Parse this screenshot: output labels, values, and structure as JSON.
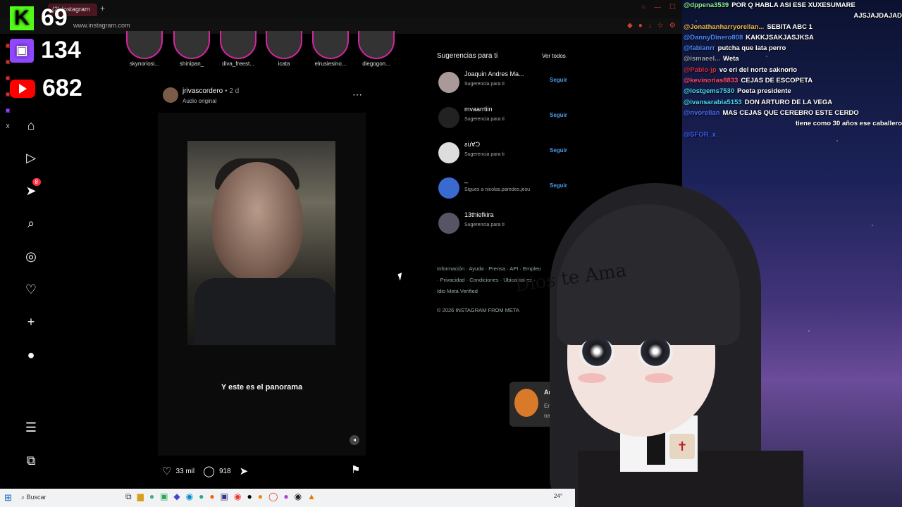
{
  "browser": {
    "tab_title": "(2) Instagram",
    "url": "www.instagram.com"
  },
  "counters": {
    "kick": "69",
    "twitch": "134",
    "youtube": "682"
  },
  "stories": [
    {
      "name": "skynoriosi..."
    },
    {
      "name": "shinipan_"
    },
    {
      "name": "diva_freest..."
    },
    {
      "name": "icata"
    },
    {
      "name": "elrusiesino..."
    },
    {
      "name": "diegogon..."
    }
  ],
  "nav": {
    "notifications_badge": "8"
  },
  "post": {
    "username": "jrivascordero",
    "time": "2 d",
    "audio": "Audio original",
    "subtitle": "Y este es el panorama",
    "likes": "33 mil",
    "comments": "918"
  },
  "suggestions": {
    "title": "Sugerencias para ti",
    "see_all": "Ver todos",
    "follow_label": "Seguir",
    "items": [
      {
        "name": "Joaquin Andres Ma...",
        "sub": "Sugerencia para ti"
      },
      {
        "name": "mvaarrtiin",
        "sub": "Sugerencia para ti"
      },
      {
        "name": "ƨiɹⱯϽ",
        "sub": "Sugerencia para ti"
      },
      {
        "name": "_",
        "sub": "Sigues a nicolas.paredes.jesu"
      },
      {
        "name": "13thiefkira",
        "sub": "Sugerencia para ti"
      }
    ]
  },
  "footer": {
    "links": "Información · Ayuda · Prensa · API · Empleo · Privacidad · Condiciones · Ubicaciones · Idio Meta Verified",
    "copyright": "© 2026 INSTAGRAM FROM META"
  },
  "toast": {
    "name": "Annie lot",
    "text1": "Envió un ree",
    "text2": "nackson6g",
    "fab_badge": "9+"
  },
  "chat": [
    {
      "user": "@dppena3539",
      "msg": "POR Q HABLA ASI ESE XUXESUMARE",
      "color": "#8cf08c"
    },
    {
      "user": "",
      "msg": "AJSJAJDAJAD",
      "color": "#ffffff"
    },
    {
      "user": "@Jonathanharryorellan...",
      "msg": "SEBITA ABC 1",
      "color": "#e8b84a"
    },
    {
      "user": "@DannyDinero808",
      "msg": "KAKKJSAKJASJKSA",
      "color": "#4a8cff"
    },
    {
      "user": "@fabianrr",
      "msg": "putcha que lata perro",
      "color": "#4a8cff"
    },
    {
      "user": "@ismaeel...",
      "msg": "Weta",
      "color": "#9aa0b0"
    },
    {
      "user": "@Pablo-jp",
      "msg": "vo eri del norte saknorio",
      "color": "#d23040"
    },
    {
      "user": "@kevinorias8833",
      "msg": "CEJAS DE ESCOPETA",
      "color": "#ff4a6a"
    },
    {
      "user": "@lostgems7530",
      "msg": "Poeta presidente",
      "color": "#4adcf0"
    },
    {
      "user": "@ivansarabia5153",
      "msg": "DON ARTURO DE LA VEGA",
      "color": "#4adcf0"
    },
    {
      "user": "@nvorellan",
      "msg": "MAS CEJAS QUE CEREBRO ESTE CERDO",
      "color": "#4a6cff"
    },
    {
      "user": "",
      "msg": "tiene como 30 años ese caballero",
      "color": "#ffffff"
    },
    {
      "user": "@SFOR_x_",
      "msg": "",
      "color": "#3a5cff"
    }
  ],
  "overlay": {
    "hat_text": "Dios te Ama"
  },
  "taskbar": {
    "search_placeholder": "Buscar",
    "temp": "24°"
  }
}
